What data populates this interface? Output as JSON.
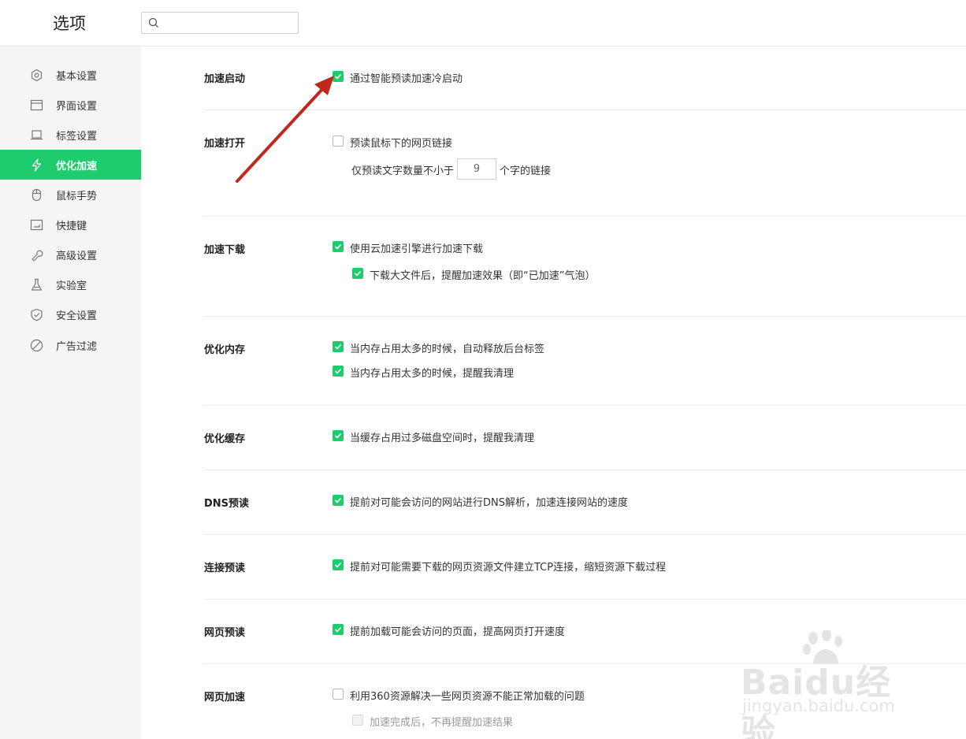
{
  "header": {
    "title": "选项",
    "search": {
      "value": "",
      "placeholder": ""
    }
  },
  "sidebar": {
    "items": [
      {
        "label": "基本设置",
        "icon": "gear-icon"
      },
      {
        "label": "界面设置",
        "icon": "window-icon"
      },
      {
        "label": "标签设置",
        "icon": "tab-icon"
      },
      {
        "label": "优化加速",
        "icon": "lightning-icon",
        "active": true
      },
      {
        "label": "鼠标手势",
        "icon": "mouse-icon"
      },
      {
        "label": "快捷键",
        "icon": "keyboard-icon"
      },
      {
        "label": "高级设置",
        "icon": "wrench-icon"
      },
      {
        "label": "实验室",
        "icon": "flask-icon"
      },
      {
        "label": "安全设置",
        "icon": "shield-icon"
      },
      {
        "label": "广告过滤",
        "icon": "block-icon"
      }
    ]
  },
  "sections": {
    "startup": {
      "title": "加速启动",
      "opt1": "通过智能预读加速冷启动",
      "opt1_checked": true
    },
    "open": {
      "title": "加速打开",
      "opt1": "预读鼠标下的网页链接",
      "opt1_checked": false,
      "count_prefix": "仅预读文字数量不小于",
      "count_value": "9",
      "count_suffix": "个字的链接"
    },
    "download": {
      "title": "加速下载",
      "opt1": "使用云加速引擎进行加速下载",
      "opt1_checked": true,
      "opt2": "下载大文件后，提醒加速效果（即“已加速”气泡）",
      "opt2_checked": true
    },
    "memory": {
      "title": "优化内存",
      "opt1": "当内存占用太多的时候，自动释放后台标签",
      "opt1_checked": true,
      "opt2": "当内存占用太多的时候，提醒我清理",
      "opt2_checked": true
    },
    "cache": {
      "title": "优化缓存",
      "opt1": "当缓存占用过多磁盘空间时，提醒我清理",
      "opt1_checked": true
    },
    "dns": {
      "title": "DNS预读",
      "opt1": "提前对可能会访问的网站进行DNS解析，加速连接网站的速度",
      "opt1_checked": true
    },
    "connect": {
      "title": "连接预读",
      "opt1": "提前对可能需要下载的网页资源文件建立TCP连接，缩短资源下载过程",
      "opt1_checked": true
    },
    "page_preload": {
      "title": "网页预读",
      "opt1": "提前加载可能会访问的页面，提高网页打开速度",
      "opt1_checked": true
    },
    "page_accel": {
      "title": "网页加速",
      "opt1": "利用360资源解决一些网页资源不能正常加载的问题",
      "opt1_checked": false,
      "opt2": "加速完成后，不再提醒加速结果",
      "opt2_checked": false,
      "opt2_disabled": true
    }
  },
  "watermark": {
    "main": "Baidu经验",
    "sub": "jingyan.baidu.com"
  },
  "colors": {
    "accent": "#1fcc6d",
    "arrow": "#c0271d"
  }
}
